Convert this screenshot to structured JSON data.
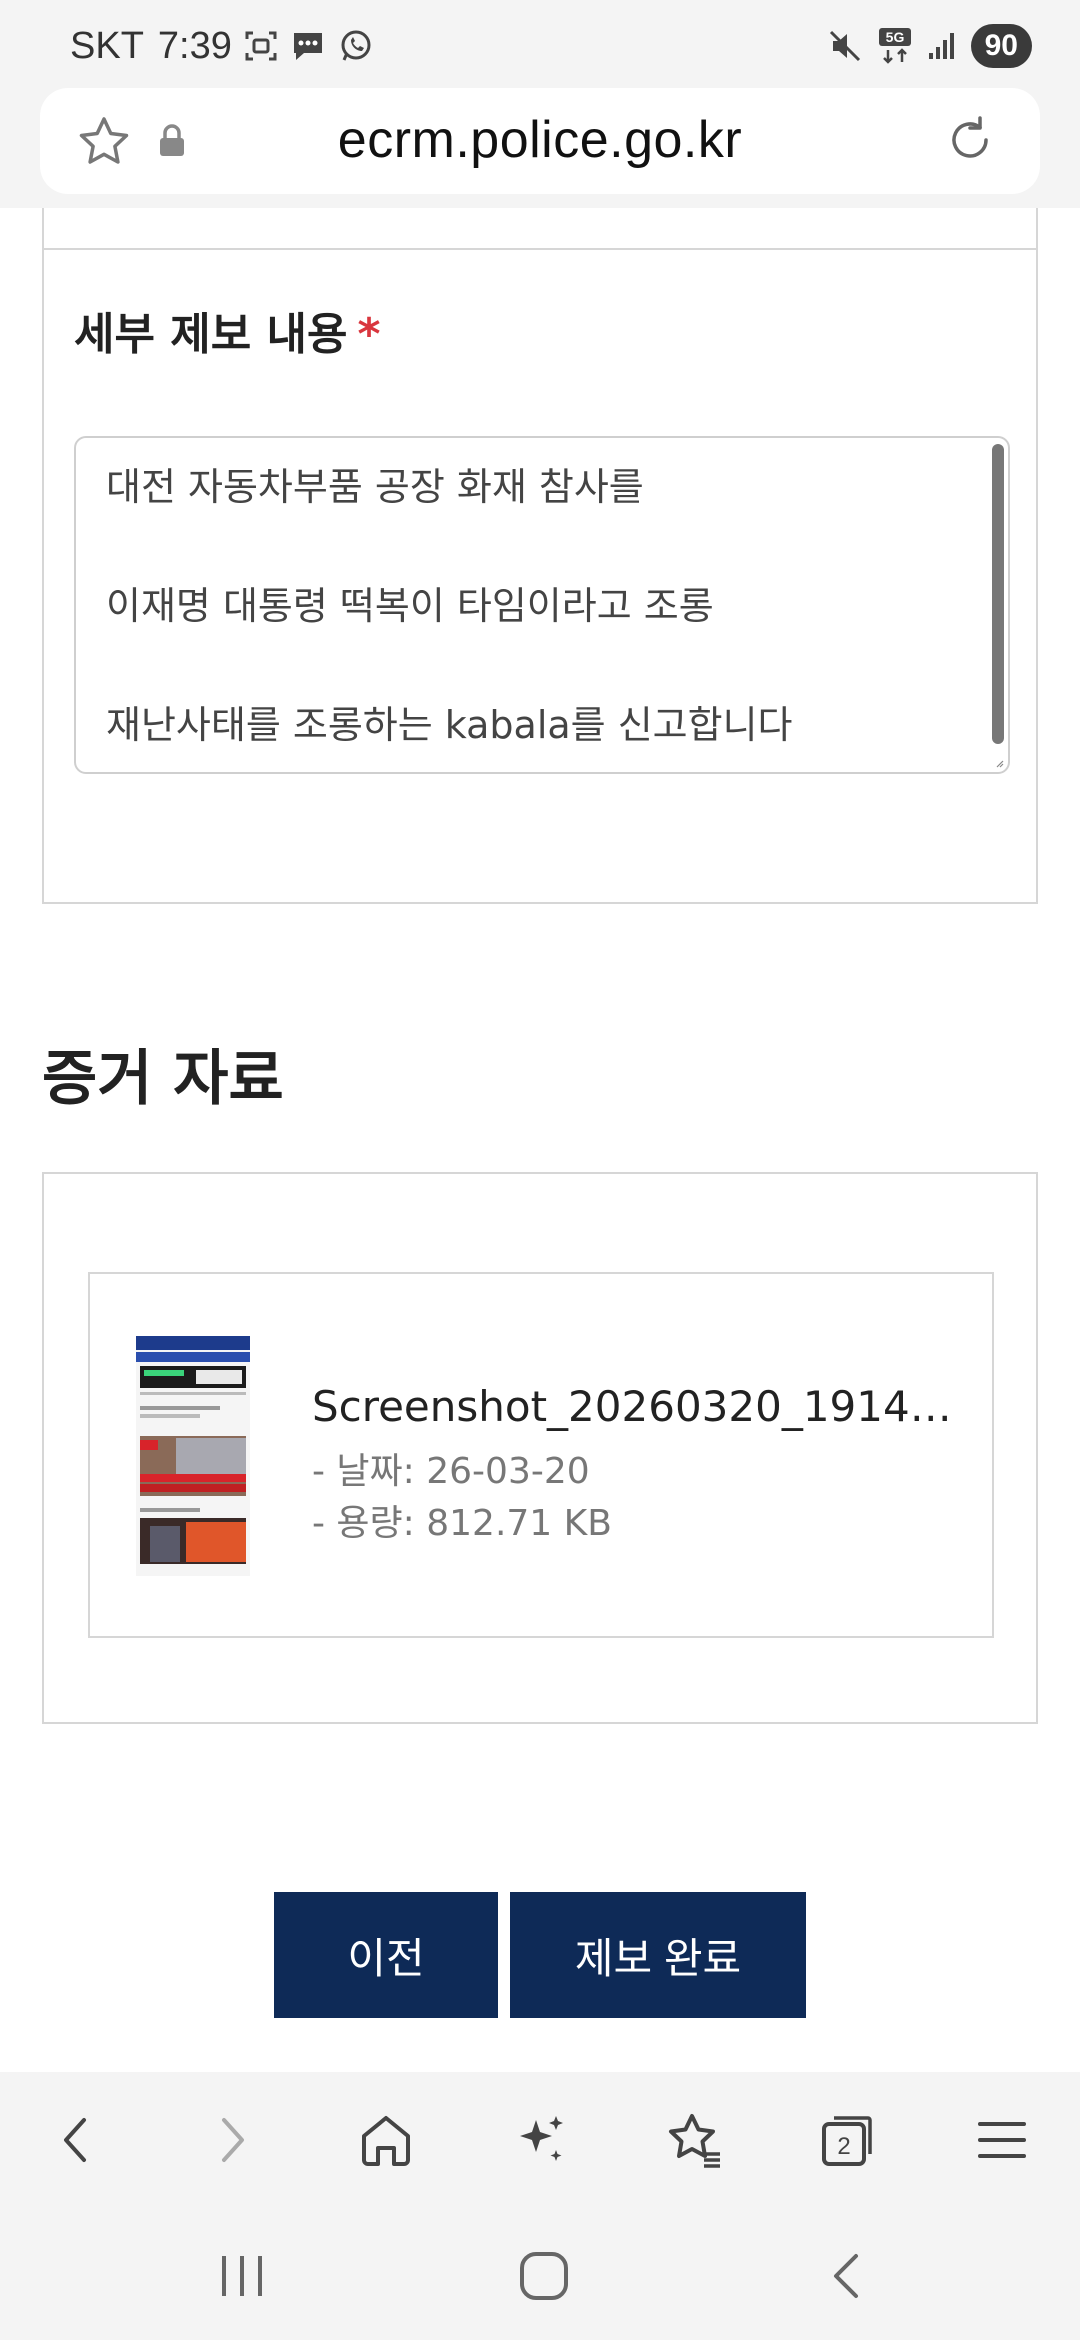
{
  "status_bar": {
    "carrier": "SKT",
    "time": "7:39",
    "network": "5G",
    "battery": "90",
    "icons": [
      "screenshot-icon",
      "chat-icon",
      "whatsapp-icon",
      "mute-icon",
      "5g-data-icon",
      "signal-icon"
    ]
  },
  "browser": {
    "url": "ecrm.police.go.kr",
    "icons": [
      "star-icon",
      "lock-icon",
      "reload-icon"
    ]
  },
  "form": {
    "detail_label": "세부 제보 내용",
    "required_mark": "*",
    "detail_lines": [
      "대전 자동차부품 공장 화재 참사를",
      "이재명 대통령 떡복이 타임이라고 조롱",
      "재난사태를 조롱하는 kabala를 신고합니다"
    ]
  },
  "evidence": {
    "title": "증거 자료",
    "file": {
      "name": "Screenshot_20260320_19143…",
      "date": "- 날짜: 26-03-20",
      "size": "- 용량: 812.71 KB",
      "thumbnail_text": "대전 공장 대형 화재\n53명 중경상, 14명 연락두절"
    }
  },
  "buttons": {
    "prev": "이전",
    "submit": "제보 완료"
  },
  "browser_toolbar": {
    "tab_count": "2",
    "icons": [
      "back-icon",
      "forward-icon",
      "home-icon",
      "ai-sparkle-icon",
      "bookmarks-icon",
      "tabs-icon",
      "menu-icon"
    ]
  },
  "system_nav": {
    "icons": [
      "recents-icon",
      "home-button-icon",
      "system-back-icon"
    ]
  },
  "colors": {
    "button_bg": "#0e2a57",
    "required": "#d9363e",
    "chrome_bg": "#f4f4f4"
  }
}
